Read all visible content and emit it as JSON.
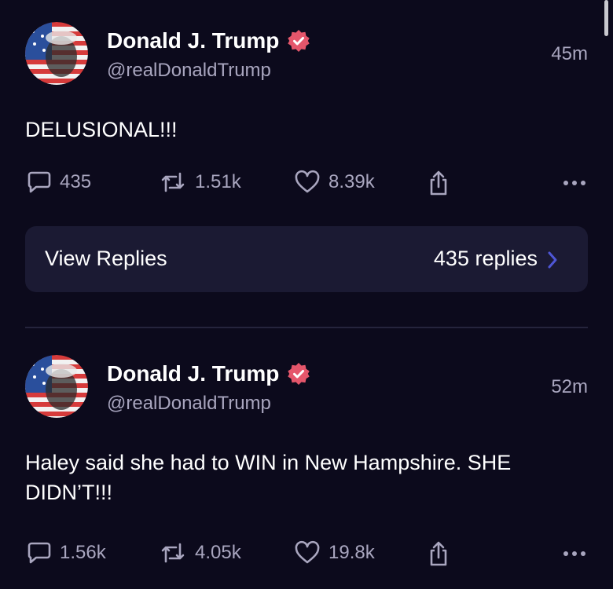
{
  "posts": [
    {
      "author": "Donald J. Trump",
      "handle": "@realDonaldTrump",
      "time": "45m",
      "text": "DELUSIONAL!!!",
      "replies": "435",
      "reposts": "1.51k",
      "likes": "8.39k"
    },
    {
      "author": "Donald J. Trump",
      "handle": "@realDonaldTrump",
      "time": "52m",
      "text": "Haley said she had to WIN in New Hampshire. SHE DIDN’T!!!",
      "replies": "1.56k",
      "reposts": "4.05k",
      "likes": "19.8k"
    }
  ],
  "view_replies": {
    "label": "View Replies",
    "count": "435 replies"
  },
  "icons": {
    "reply": "speech-bubble-icon",
    "repost": "repost-arrows-icon",
    "like": "heart-icon",
    "share": "share-up-icon",
    "more": "more-dots-icon",
    "verified": "verified-badge-icon"
  },
  "colors": {
    "background": "#0c0a1c",
    "card": "#1b1a33",
    "muted_text": "#a9a6bf",
    "verified_badge": "#e5566b",
    "chevron": "#4e56d6"
  }
}
